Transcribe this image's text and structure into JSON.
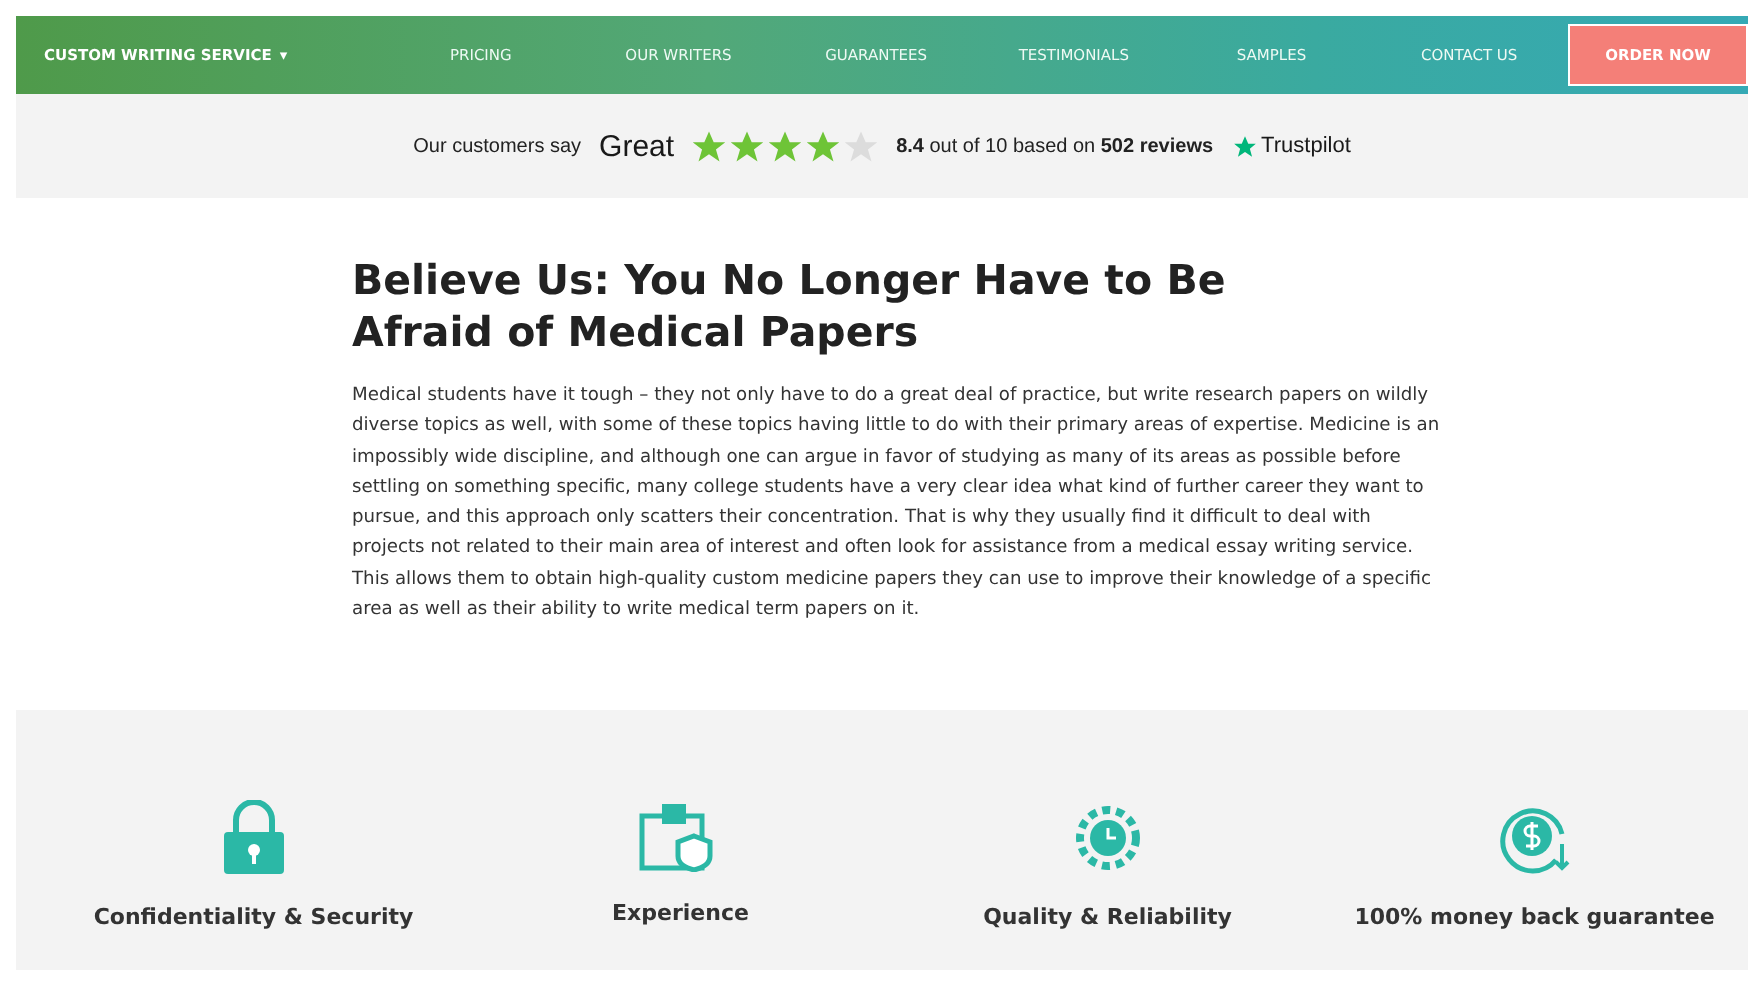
{
  "nav": {
    "brand": "CUSTOM WRITING SERVICE",
    "caret": "▾",
    "links": [
      "PRICING",
      "OUR WRITERS",
      "GUARANTEES",
      "TESTIMONIALS",
      "SAMPLES",
      "CONTACT US"
    ],
    "cta": "ORDER NOW"
  },
  "rating_bar": {
    "lead": "Our customers say",
    "verdict": "Great",
    "stars": 4,
    "summary": "**8.4** out of 10 based on **502 reviews**",
    "brand": "Trustpilot"
  },
  "article": {
    "title": "Believe Us: You No Longer Have to Be Afraid of Medical Papers",
    "body": "Medical students have it tough – they not only have to do a great deal of practice, but write research papers on wildly diverse topics as well, with some of these topics having little to do with their primary areas of expertise. Medicine is an impossibly wide discipline, and although one can argue in favor of studying as many of its areas as possible before settling on something specific, many college students have a very clear idea what kind of further career they want to pursue, and this approach only scatters their concentration. That is why they usually find it difficult to deal with projects not related to their main area of interest and often look for assistance from a medical essay writing service. This allows them to obtain high-quality custom medicine papers they can use to improve their knowledge of a specific area as well as their ability to write medical term papers on it."
  },
  "features": [
    {
      "kind": "lock",
      "title": "Confidentiality & Security"
    },
    {
      "kind": "briefcase",
      "title": "Experience"
    },
    {
      "kind": "gear",
      "title": "Quality & Reliability"
    },
    {
      "kind": "money",
      "title": "100% money back guarantee"
    }
  ]
}
